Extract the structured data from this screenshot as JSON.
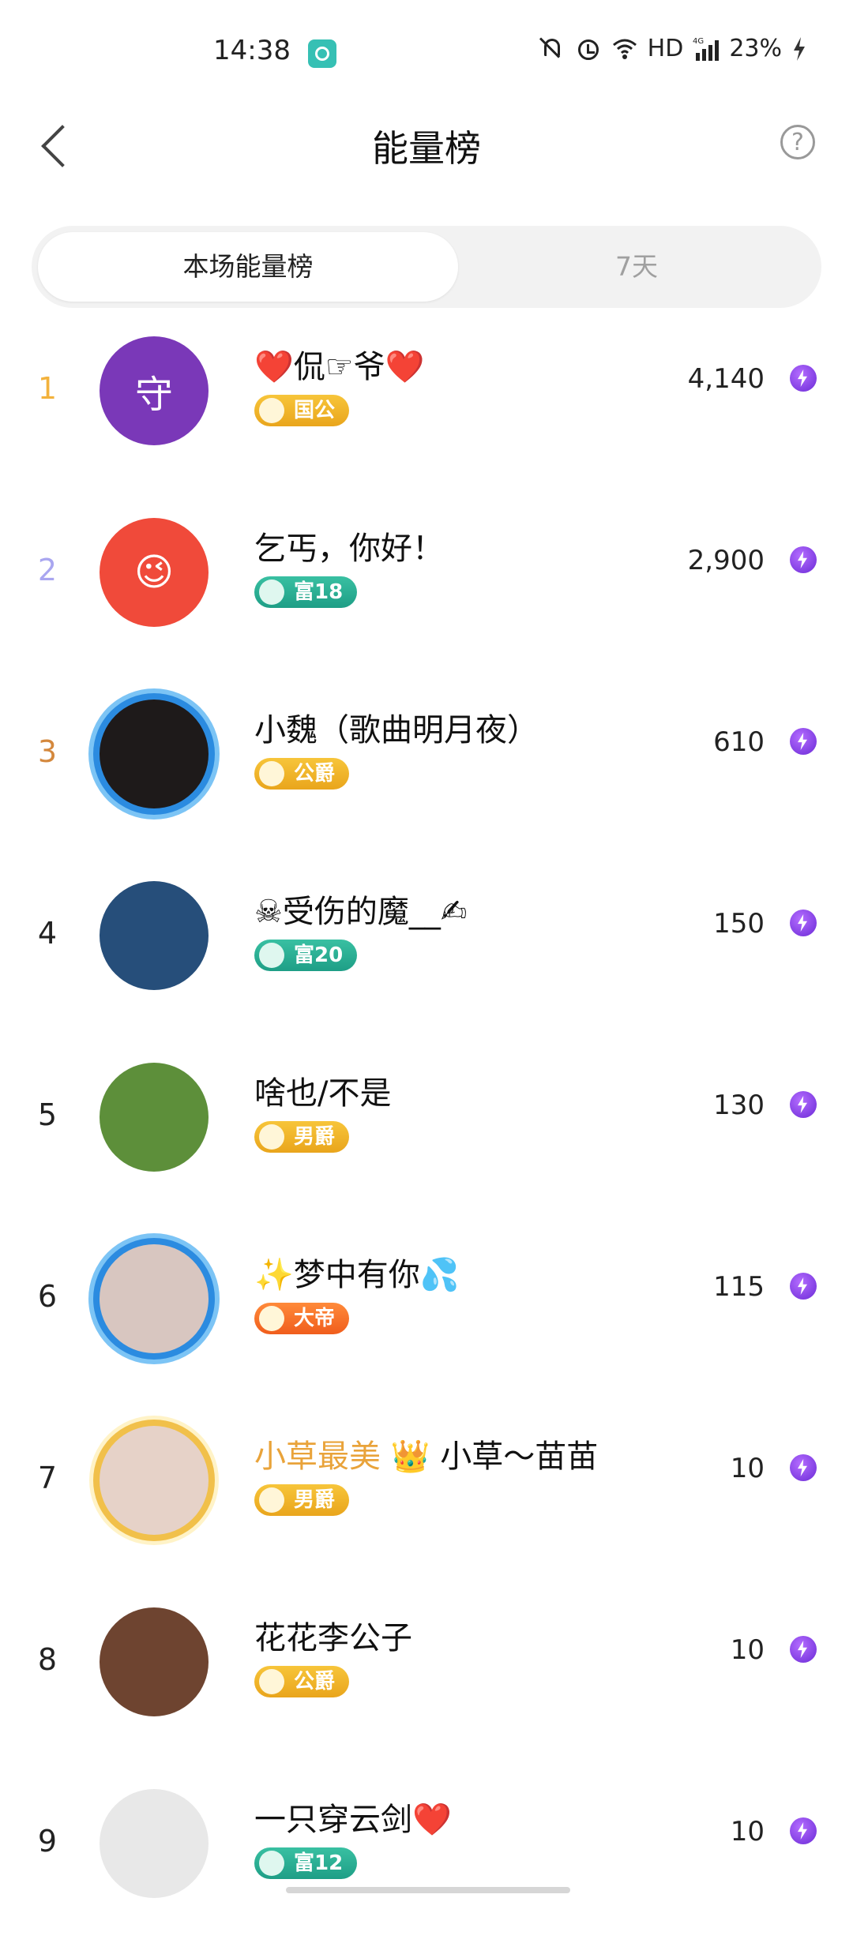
{
  "status_bar": {
    "time": "14:38",
    "network": "HD",
    "network_type": "4G",
    "battery": "23%"
  },
  "header": {
    "title": "能量榜",
    "help_label": "?"
  },
  "tabs": [
    {
      "label": "本场能量榜",
      "active": true
    },
    {
      "label": "7天",
      "active": false
    }
  ],
  "rows": [
    {
      "rank": "1",
      "rank_color": "#f3b23c",
      "name": "❤️侃☞爷❤️",
      "name_prefix": "",
      "badge": "国公",
      "badge_style": "gold",
      "score": "4,140",
      "avatar_color": "#7a38b8",
      "avatar_text": "守"
    },
    {
      "rank": "2",
      "rank_color": "#a9a6f0",
      "name": "乞丐，你好！",
      "name_prefix": "",
      "badge": "富18",
      "badge_style": "teal",
      "score": "2,900",
      "avatar_color": "#f04a3a",
      "avatar_text": "😉"
    },
    {
      "rank": "3",
      "rank_color": "#d4883d",
      "name": "小魏（歌曲明月夜）",
      "name_prefix": "",
      "badge": "公爵",
      "badge_style": "gold",
      "score": "610",
      "avatar_color": "#1e1a1a",
      "avatar_text": ""
    },
    {
      "rank": "4",
      "rank_color": "#222222",
      "name": "☠受伤的魔__✍",
      "name_prefix": "",
      "badge": "富20",
      "badge_style": "teal",
      "score": "150",
      "avatar_color": "#264e7a",
      "avatar_text": ""
    },
    {
      "rank": "5",
      "rank_color": "#222222",
      "name": "啥也/不是",
      "name_prefix": "",
      "badge": "男爵",
      "badge_style": "gold",
      "score": "130",
      "avatar_color": "#5d8f3a",
      "avatar_text": ""
    },
    {
      "rank": "6",
      "rank_color": "#222222",
      "name": "✨梦中有你💦",
      "name_prefix": "",
      "badge": "大帝",
      "badge_style": "orange",
      "score": "115",
      "avatar_color": "#d8c6c0",
      "avatar_text": ""
    },
    {
      "rank": "7",
      "rank_color": "#222222",
      "name": "小草～苗苗",
      "name_prefix": "小草最美 👑 ",
      "badge": "男爵",
      "badge_style": "gold",
      "score": "10",
      "avatar_color": "#e6d2c8",
      "avatar_text": ""
    },
    {
      "rank": "8",
      "rank_color": "#222222",
      "name": "花花李公子",
      "name_prefix": "",
      "badge": "公爵",
      "badge_style": "gold",
      "score": "10",
      "avatar_color": "#6e4430",
      "avatar_text": ""
    },
    {
      "rank": "9",
      "rank_color": "#222222",
      "name": "一只穿云剑❤️",
      "name_prefix": "",
      "badge": "富12",
      "badge_style": "teal",
      "score": "10",
      "avatar_color": "#e8e8e8",
      "avatar_text": ""
    }
  ]
}
